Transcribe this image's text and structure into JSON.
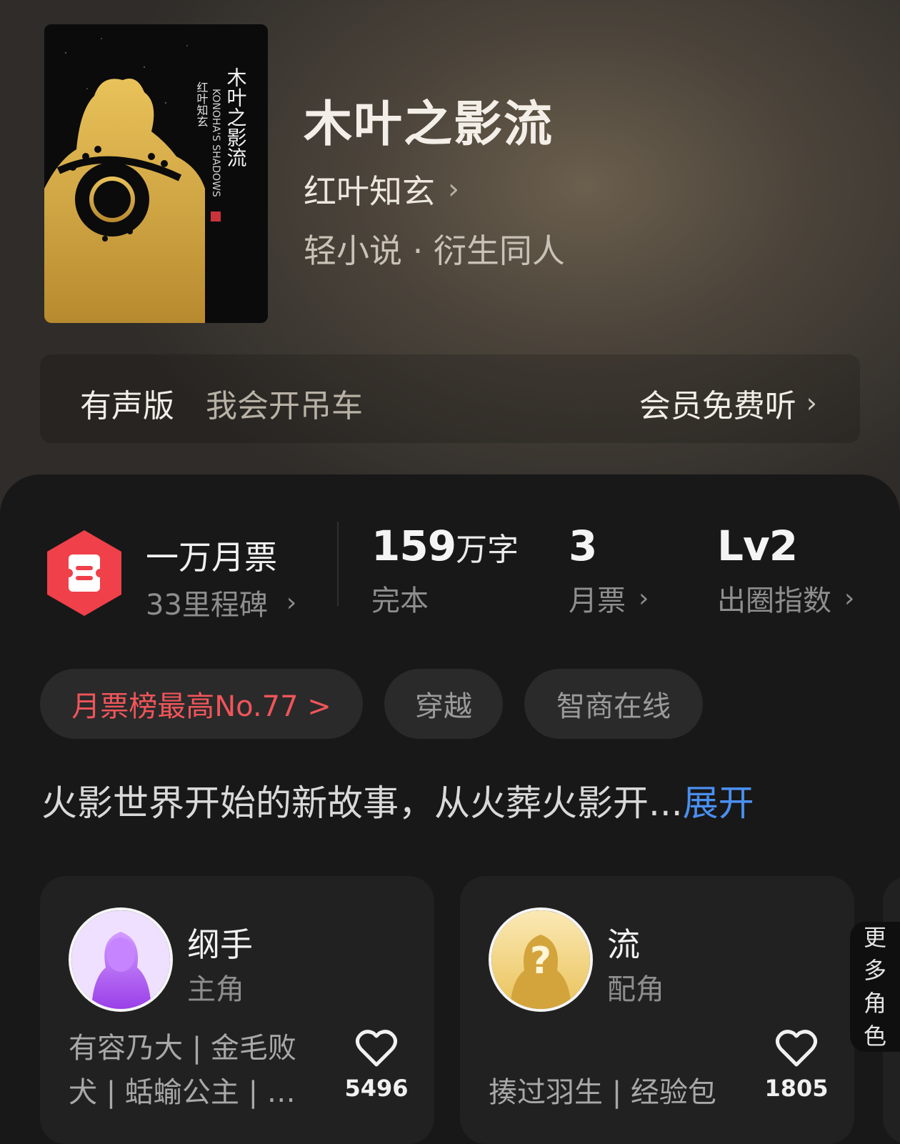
{
  "book": {
    "cover_title": "木叶之影流",
    "cover_author": "红叶知玄",
    "cover_en": "KONOHA'S SHADOWS",
    "title": "木叶之影流",
    "author": "红叶知玄",
    "genre": "轻小说 · 衍生同人"
  },
  "audio": {
    "tag": "有声版",
    "name": "我会开吊车",
    "cta": "会员免费听"
  },
  "stats": {
    "ticket_title": "一万月票",
    "ticket_sub": "33里程碑",
    "words_num": "159",
    "words_unit": "万字",
    "words_label": "完本",
    "tickets_num": "3",
    "tickets_label": "月票",
    "level_num": "Lv2",
    "level_label": "出圈指数"
  },
  "chips": [
    "月票榜最高No.77 >",
    "穿越",
    "智商在线"
  ],
  "synopsis": {
    "text": "火影世界开始的新故事，从火葬火影开...",
    "expand": "展开"
  },
  "characters": [
    {
      "name": "纲手",
      "role": "主角",
      "tags": "有容乃大 | 金毛败犬 | 蛞蝓公主 | …",
      "likes": "5496"
    },
    {
      "name": "流",
      "role": "配角",
      "tags": "揍过羽生 | 经验包",
      "likes": "1805"
    }
  ],
  "more_roles": [
    "更",
    "多",
    "角",
    "色"
  ],
  "colors": {
    "rank_red": "#f0555a",
    "expand_blue": "#4a8ff0",
    "hex_badge": "#f0404a",
    "panel_bg": "#181818"
  },
  "icons": [
    "ticket-hex-icon",
    "chevron-right-icon",
    "heart-outline-icon"
  ]
}
